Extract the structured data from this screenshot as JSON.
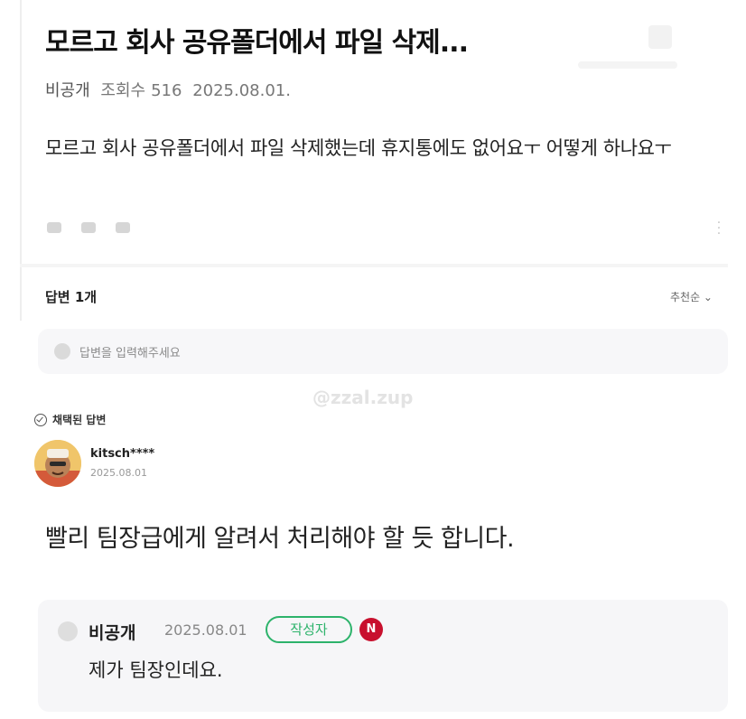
{
  "post": {
    "title": "모르고 회사 공유폴더에서 파일 삭제...",
    "author": "비공개",
    "views_label": "조회수",
    "views": "516",
    "date": "2025.08.01.",
    "body": "모르고 회사 공유폴더에서 파일 삭제했는데 휴지통에도 없어요ㅜ 어떻게 하나요ㅜ"
  },
  "answers": {
    "count_label": "답변 1개",
    "sort_label": "추천순 ⌄",
    "input_placeholder": "답변을 입력해주세요"
  },
  "watermark": "@zzal.zup",
  "selected_answer": {
    "badge": "채택된 답변",
    "user": "kitsch****",
    "date": "2025.08.01",
    "text": "빨리 팀장급에게 알려서 처리해야 할 듯 합니다."
  },
  "reply": {
    "user": "비공개",
    "date": "2025.08.01",
    "author_badge": "작성자",
    "n_badge": "N",
    "text": "제가 팀장인데요."
  },
  "colors": {
    "author_badge": "#2db36b",
    "n_badge": "#c8102e"
  },
  "icons": [
    "heart-icon",
    "comment-icon",
    "share-icon",
    "more-icon",
    "check-circle-icon",
    "avatar-icon"
  ]
}
